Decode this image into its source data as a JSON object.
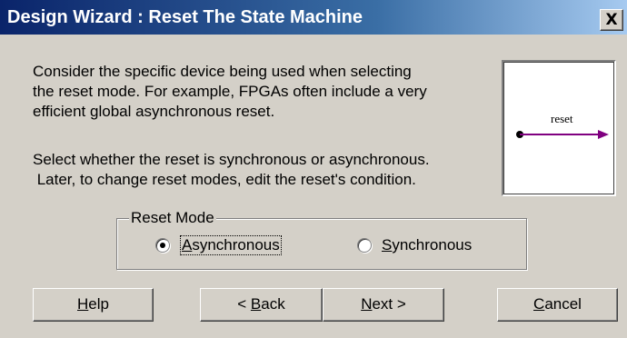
{
  "window": {
    "title": "Design Wizard : Reset The State Machine",
    "close_glyph": "X"
  },
  "description": {
    "para1": [
      "Consider the specific device being used when selecting",
      "the reset mode.  For example, FPGAs often include a very",
      "efficient global asynchronous reset."
    ],
    "para2": [
      "Select whether the reset is synchronous or asynchronous.",
      " Later, to change reset modes, edit the reset's condition."
    ]
  },
  "preview": {
    "label": "reset",
    "line_color": "#800080"
  },
  "reset_mode": {
    "legend": "Reset Mode",
    "options": [
      {
        "label": "Asynchronous",
        "selected": true
      },
      {
        "label": "Synchronous",
        "selected": false
      }
    ]
  },
  "buttons": {
    "help": "Help",
    "back": "< Back",
    "next": "Next >",
    "cancel": "Cancel"
  },
  "colors": {
    "title_bar_start": "#0a246a",
    "title_bar_end": "#a6caf0",
    "dialog_bg": "#d4d0c8"
  }
}
